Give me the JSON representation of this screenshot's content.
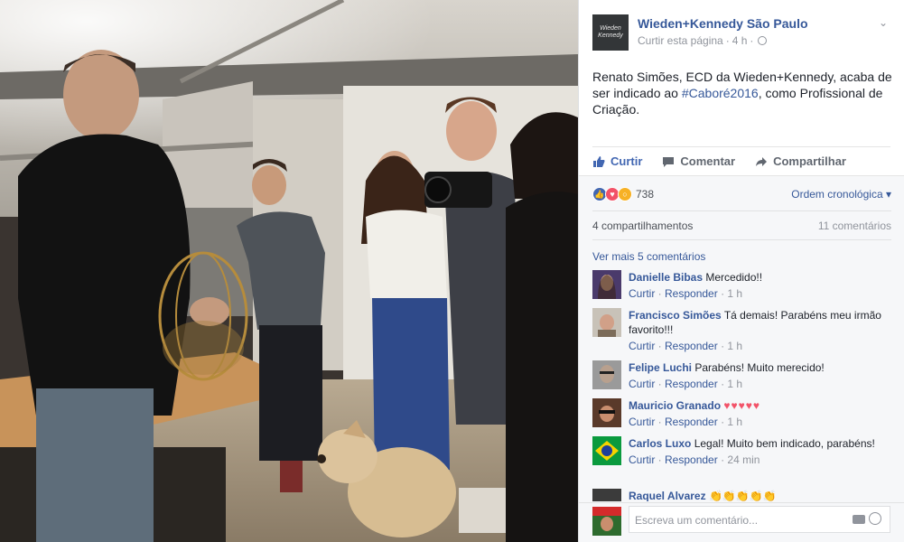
{
  "post": {
    "page_name": "Wieden+Kennedy São Paulo",
    "avatar_line1": "Wieden",
    "avatar_line2": "Kennedy",
    "like_page": "Curtir esta página",
    "dot": "·",
    "time": "4 h",
    "dot2": "·",
    "text_before": "Renato Simões, ECD da Wieden+Kennedy, acaba de ser indicado ao ",
    "hashtag": "#Caboré2016",
    "text_after": ", como Profissional de Criação."
  },
  "actions": {
    "like": "Curtir",
    "comment": "Comentar",
    "share": "Compartilhar"
  },
  "feedback": {
    "reaction_count": "738",
    "order": "Ordem cronológica",
    "shares": "4 compartilhamentos",
    "comments_count": "11 comentários",
    "more_comments": "Ver mais 5 comentários"
  },
  "comments": [
    {
      "author": "Danielle Bibas",
      "text": "Mercedido!!",
      "like": "Curtir",
      "reply": "Responder",
      "time": "1 h"
    },
    {
      "author": "Francisco Simões",
      "text": "Tá demais! Parabéns meu irmão favorito!!!",
      "like": "Curtir",
      "reply": "Responder",
      "time": "1 h"
    },
    {
      "author": "Felipe Luchi",
      "text": "Parabéns! Muito merecido!",
      "like": "Curtir",
      "reply": "Responder",
      "time": "1 h"
    },
    {
      "author": "Mauricio Granado",
      "text": "♥♥♥♥♥",
      "like": "Curtir",
      "reply": "Responder",
      "time": "1 h"
    },
    {
      "author": "Carlos Luxo",
      "text": "Legal! Muito bem indicado, parabéns!",
      "like": "Curtir",
      "reply": "Responder",
      "time": "24 min"
    },
    {
      "author": "Raquel Alvarez",
      "text": "👏👏👏👏👏"
    }
  ],
  "write": {
    "placeholder": "Escreva um comentário..."
  },
  "colors": {
    "link": "#365899",
    "like_blue": "#4267b2",
    "love_red": "#f25268",
    "wow_yellow": "#f7b125"
  }
}
